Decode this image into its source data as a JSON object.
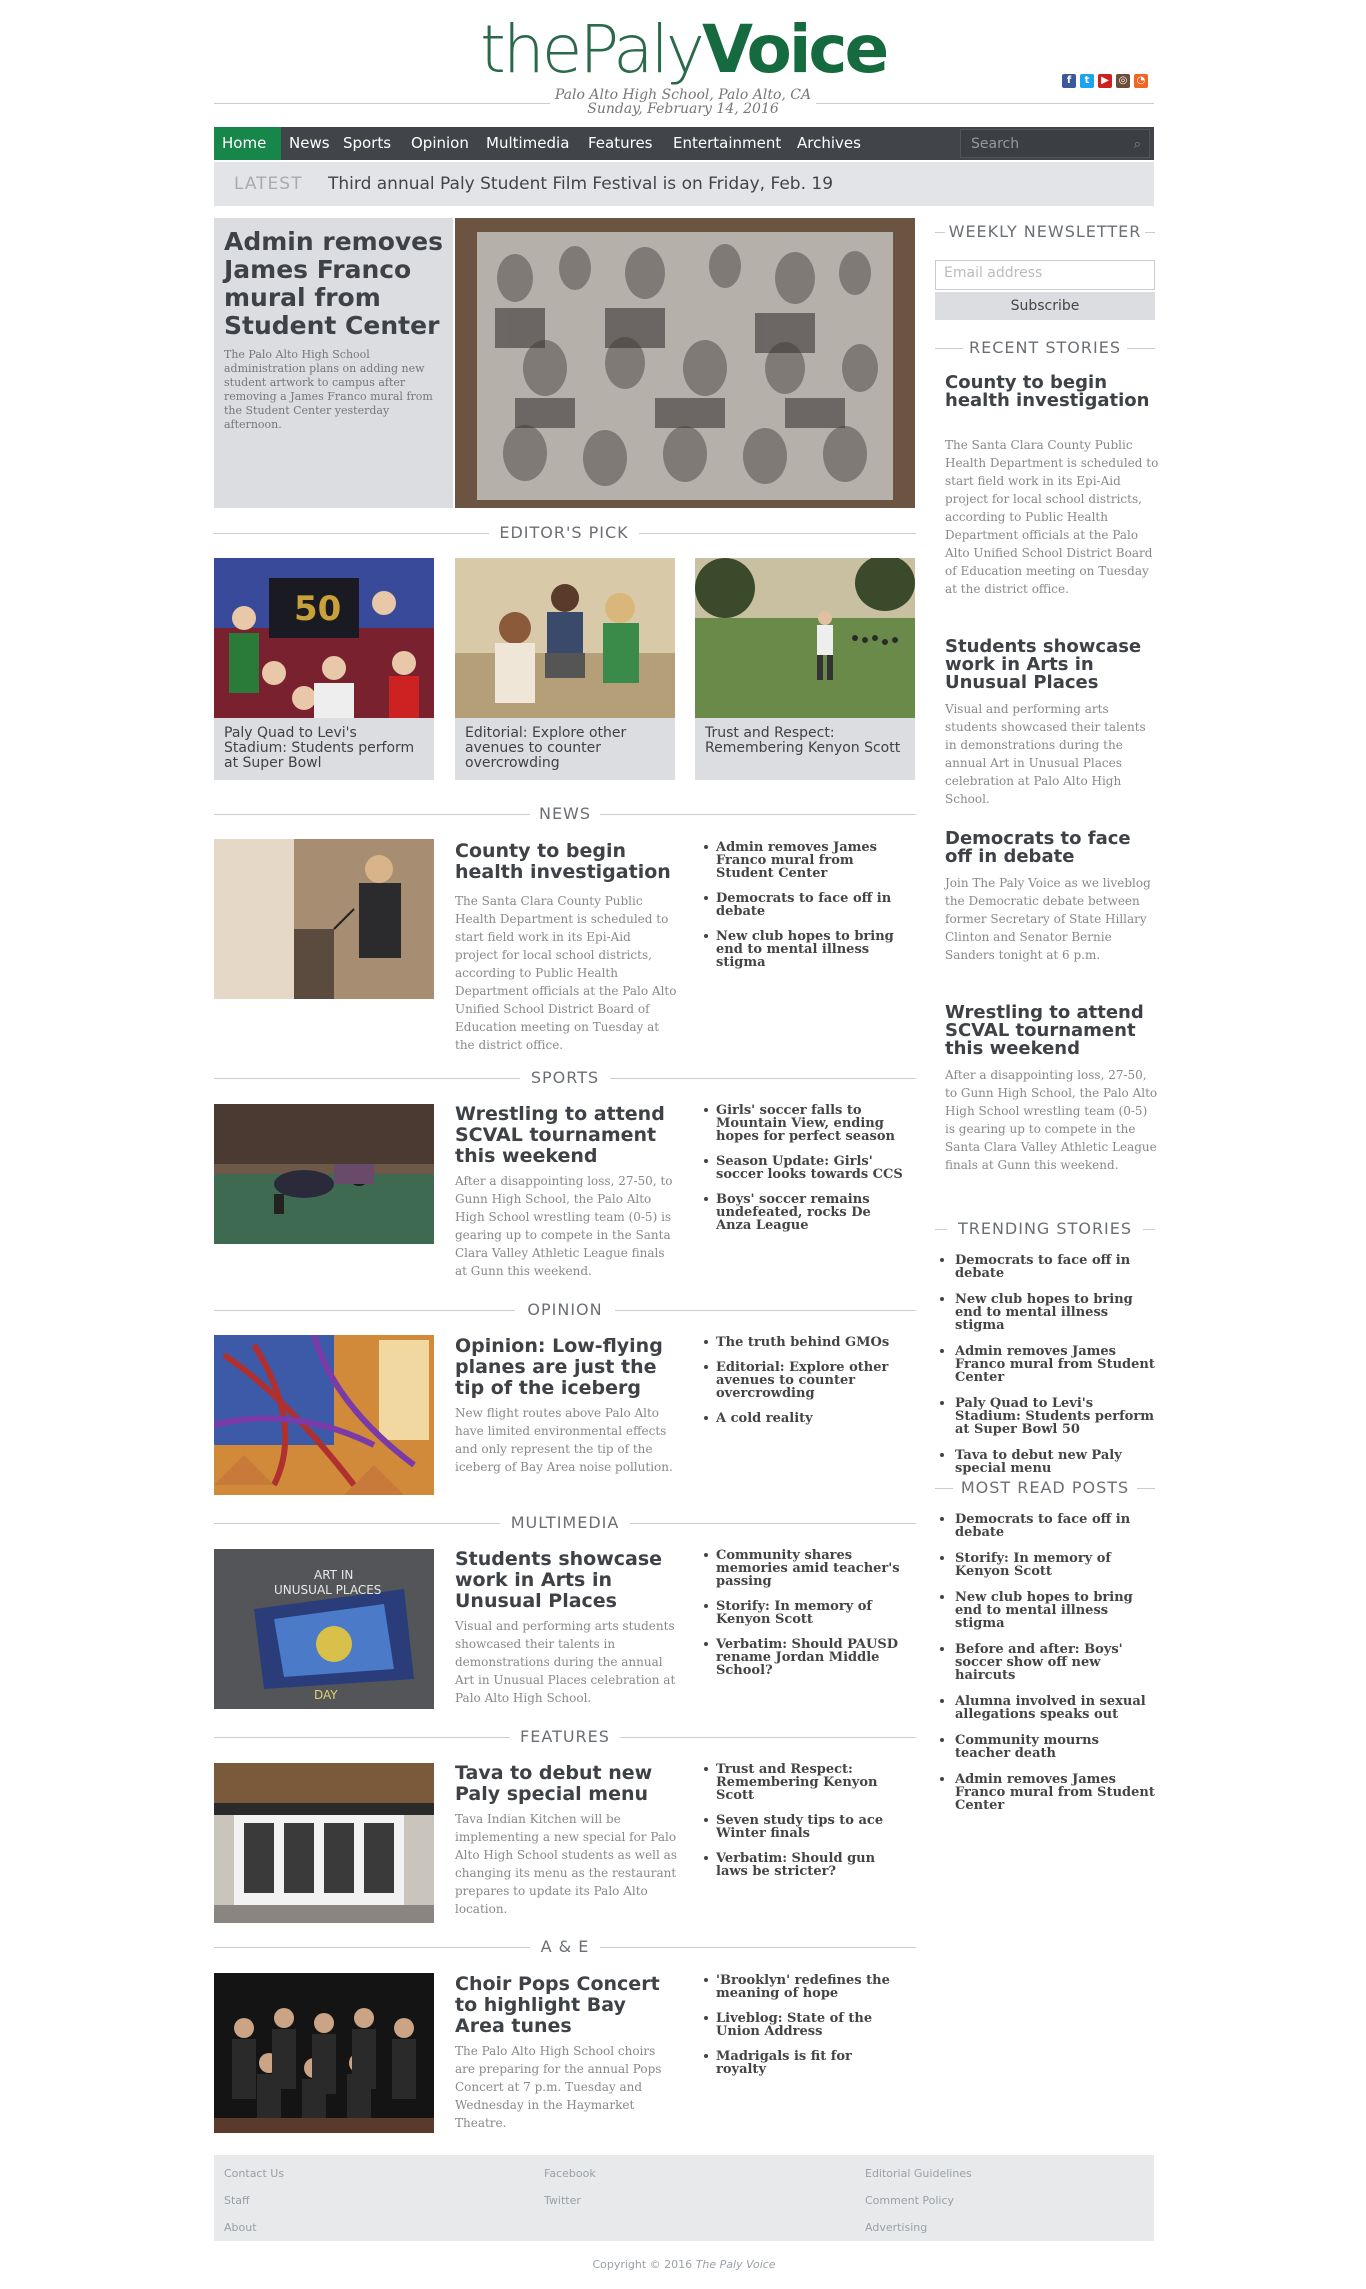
{
  "masthead": {
    "logo_part1": "thePaly",
    "logo_part2": "Voice",
    "location": "Palo Alto High School, Palo Alto, CA",
    "date": "Sunday, February 14, 2016"
  },
  "social": [
    {
      "icon": "facebook-icon",
      "glyph": "f",
      "color": "#3b5998"
    },
    {
      "icon": "twitter-icon",
      "glyph": "t",
      "color": "#1da1f2"
    },
    {
      "icon": "youtube-icon",
      "glyph": "▶",
      "color": "#cd201f"
    },
    {
      "icon": "instagram-icon",
      "glyph": "◎",
      "color": "#6b4d3a"
    },
    {
      "icon": "rss-icon",
      "glyph": "◔",
      "color": "#f26522"
    }
  ],
  "nav": {
    "items": [
      "Home",
      "News",
      "Sports",
      "Opinion",
      "Multimedia",
      "Features",
      "Entertainment",
      "Archives"
    ],
    "search_placeholder": "Search"
  },
  "latest": {
    "label": "LATEST",
    "text": "Third annual Paly Student Film Festival is on Friday, Feb. 19"
  },
  "featured": {
    "title": "Admin removes James Franco mural from Student Center",
    "text": "The Palo Alto High School administration plans on adding new student artwork to campus after removing a James Franco mural from the Student Center yesterday afternoon."
  },
  "editors_pick": {
    "heading": "EDITOR'S PICK",
    "cards": [
      "Paly Quad to Levi's Stadium: Students perform at Super Bowl",
      "Editorial: Explore other avenues to counter overcrowding",
      "Trust and Respect: Remembering Kenyon Scott"
    ]
  },
  "sections": [
    {
      "heading": "NEWS",
      "title": "County to begin health investigation",
      "text": "The Santa Clara County Public Health Department is scheduled to start field work in its Epi-Aid project for local school districts, according to Public Health Department officials at the Palo Alto Unified School District Board of Education meeting on Tuesday at the district office.",
      "links": [
        "Admin removes James Franco mural from Student Center",
        "Democrats to face off in debate",
        "New club hopes to bring end to mental illness stigma"
      ]
    },
    {
      "heading": "SPORTS",
      "title": "Wrestling to attend SCVAL tournament this weekend",
      "text": "After a disappointing loss, 27-50, to Gunn High School, the Palo Alto High School wrestling team (0-5) is gearing up to compete in the Santa Clara Valley Athletic League finals at Gunn this weekend.",
      "links": [
        "Girls' soccer falls to Mountain View, ending hopes for perfect season",
        "Season Update: Girls' soccer looks towards CCS",
        "Boys' soccer remains undefeated, rocks De Anza League"
      ]
    },
    {
      "heading": "OPINION",
      "title": "Opinion: Low-flying planes are just the tip of the iceberg",
      "text": "New flight routes above Palo Alto have limited environmental effects and only represent the tip of the iceberg of Bay Area noise pollution.",
      "links": [
        "The truth behind GMOs",
        "Editorial: Explore other avenues to counter overcrowding",
        "A cold reality"
      ]
    },
    {
      "heading": "MULTIMEDIA",
      "title": "Students showcase work in Arts in Unusual Places",
      "text": "Visual and performing arts students showcased their talents in demonstrations during the annual Art in Unusual Places celebration at Palo Alto High School.",
      "links": [
        "Community shares memories amid teacher's passing",
        "Storify: In memory of Kenyon Scott",
        "Verbatim: Should PAUSD rename Jordan Middle School?"
      ]
    },
    {
      "heading": "FEATURES",
      "title": "Tava to debut new Paly special menu",
      "text": "Tava Indian Kitchen will be implementing a new special for Palo Alto High School students as well as changing its menu as the restaurant prepares to update its Palo Alto location.",
      "links": [
        "Trust and Respect: Remembering Kenyon Scott",
        "Seven study tips to ace Winter finals",
        "Verbatim: Should gun laws be stricter?"
      ]
    },
    {
      "heading": "A & E",
      "title": "Choir Pops Concert to highlight Bay Area tunes",
      "text": "The Palo Alto High School choirs are preparing for the annual Pops Concert at 7 p.m. Tuesday and Wednesday in the Haymarket Theatre.",
      "links": [
        "'Brooklyn' redefines the meaning of hope",
        "Liveblog: State of the Union Address",
        "Madrigals is fit for royalty"
      ]
    }
  ],
  "sidebar": {
    "newsletter_heading": "WEEKLY NEWSLETTER",
    "email_placeholder": "Email address",
    "subscribe_label": "Subscribe",
    "recent_heading": "RECENT STORIES",
    "recent": [
      {
        "title": "County to begin health investigation",
        "text": "The Santa Clara County Public Health Department is scheduled to start field work in its Epi-Aid project for local school districts, according to Public Health Department officials at the Palo Alto Unified School District Board of Education meeting on Tuesday at the district office."
      },
      {
        "title": "Students showcase work in Arts in Unusual Places",
        "text": "Visual and performing arts students showcased their talents in demonstrations during the annual Art in Unusual Places celebration at Palo Alto High School."
      },
      {
        "title": "Democrats to face off in debate",
        "text": "Join The Paly Voice as we liveblog the Democratic debate between former Secretary of State Hillary Clinton and Senator Bernie Sanders tonight at 6 p.m."
      },
      {
        "title": "Wrestling to attend SCVAL tournament this weekend",
        "text": "After a disappointing loss, 27-50, to Gunn High School, the Palo Alto High School wrestling team (0-5) is gearing up to compete in the Santa Clara Valley Athletic League finals at Gunn this weekend."
      }
    ],
    "trending_heading": "TRENDING STORIES",
    "trending": [
      "Democrats to face off in debate",
      "New club hopes to bring end to mental illness stigma",
      "Admin removes James Franco mural from Student Center",
      "Paly Quad to Levi's Stadium: Students perform at Super Bowl 50",
      "Tava to debut new Paly special menu"
    ],
    "mostread_heading": "MOST READ POSTS",
    "mostread": [
      "Democrats to face off in debate",
      "Storify: In memory of Kenyon Scott",
      "New club hopes to bring end to mental illness stigma",
      "Before and after: Boys' soccer show off new haircuts",
      "Alumna involved in sexual allegations speaks out",
      "Community mourns teacher death",
      "Admin removes James Franco mural from Student Center"
    ]
  },
  "footer": {
    "col1": [
      "Contact Us",
      "Staff",
      "About"
    ],
    "col2": [
      "Facebook",
      "Twitter"
    ],
    "col3": [
      "Editorial Guidelines",
      "Comment Policy",
      "Advertising"
    ],
    "copyright_prefix": "Copyright © 2016",
    "copyright_name": "The Paly Voice"
  }
}
